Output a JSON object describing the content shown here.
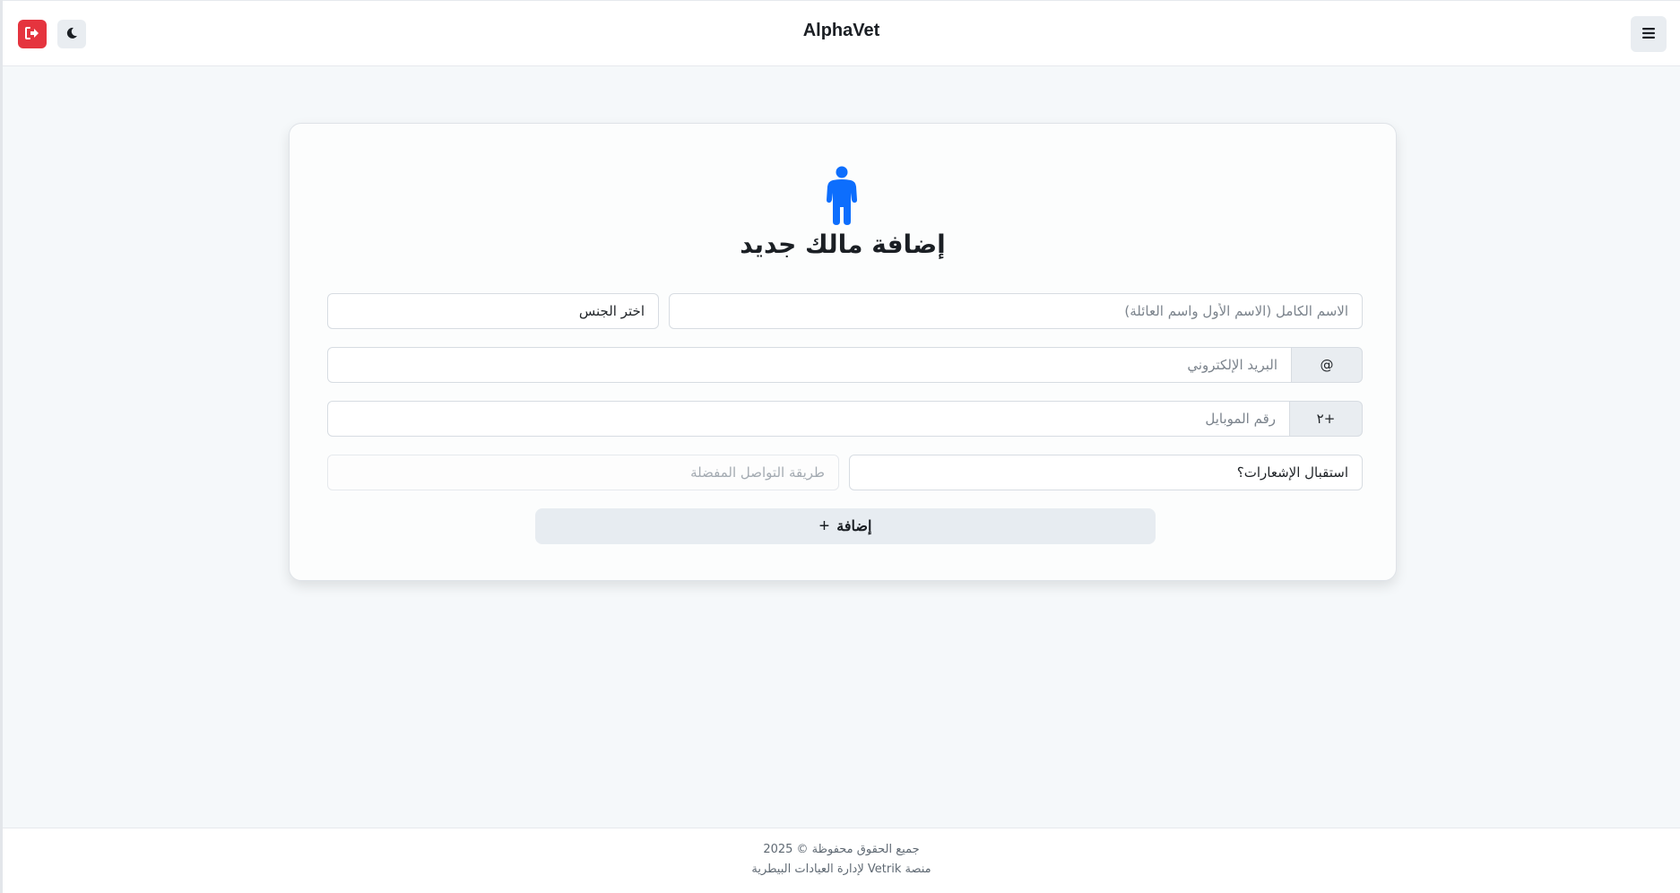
{
  "header": {
    "brand": "AlphaVet",
    "logout_icon": "logout-icon",
    "theme_icon": "moon-icon",
    "menu_icon": "hamburger-menu-icon",
    "colors": {
      "logout_bg": "#e5343e",
      "button_bg": "#e9edf1"
    }
  },
  "form": {
    "icon": "person-icon",
    "icon_color": "#0d6efd",
    "title": "إضافة مالك جديد",
    "full_name_placeholder": "الاسم الكامل (الاسم الأول واسم العائلة)",
    "gender_label": "اختر الجنس",
    "email_prefix": "@",
    "email_placeholder": "البريد الإلكتروني",
    "phone_prefix": "٢+",
    "phone_placeholder": "رقم الموبايل",
    "notifications_label": "استقبال الإشعارات؟",
    "contact_method_placeholder": "طريقة التواصل المفضلة",
    "submit_label": "إضافة",
    "submit_icon": "+"
  },
  "footer": {
    "copyright": "جميع الحقوق محفوظة © 2025",
    "tagline": "منصة Vetrik لإدارة العيادات البيطرية"
  }
}
